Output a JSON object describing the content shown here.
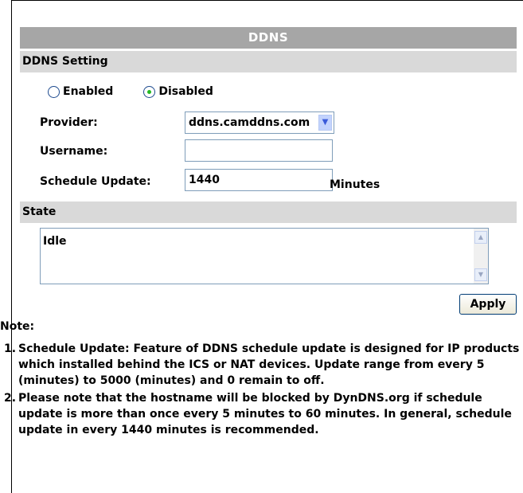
{
  "title": "DDNS",
  "ddns_setting": {
    "header": "DDNS Setting",
    "enabled_label": "Enabled",
    "disabled_label": "Disabled",
    "selected": "Disabled",
    "provider_label": "Provider:",
    "provider_value": "ddns.camddns.com",
    "username_label": "Username:",
    "username_value": "",
    "schedule_label": "Schedule Update:",
    "schedule_value": "1440",
    "schedule_unit": "Minutes"
  },
  "state": {
    "header": "State",
    "value": "Idle"
  },
  "apply_label": "Apply",
  "notes": {
    "title": "Note:",
    "items": [
      {
        "num": "1.",
        "text": "Schedule Update: Feature of DDNS schedule update is designed for IP products which installed behind the ICS or NAT devices. Update range from every 5 (minutes) to 5000 (minutes) and 0 remain to off."
      },
      {
        "num": "2.",
        "text": "Please note that the hostname will be blocked by DynDNS.org if schedule update is more than once every 5 minutes to 60 minutes. In general, schedule update in every 1440 minutes is recommended."
      }
    ]
  }
}
